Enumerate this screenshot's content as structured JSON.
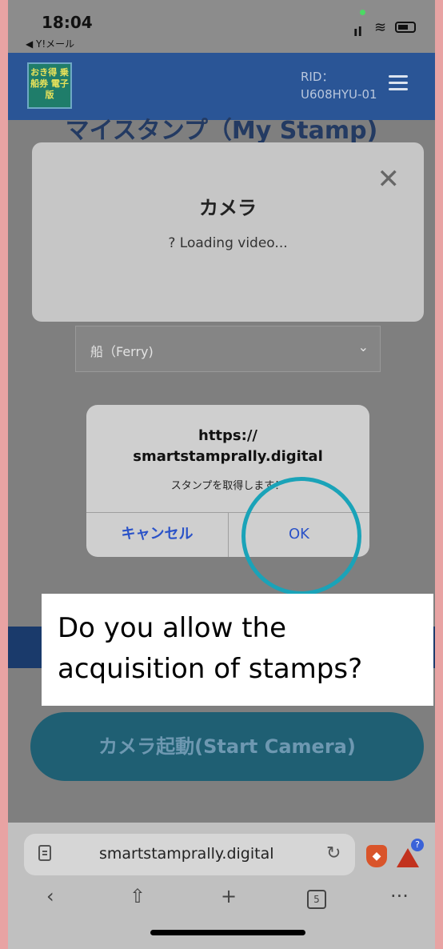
{
  "status_bar": {
    "time": "18:04",
    "back_app": "◀ Y!メール",
    "signal": "ıl",
    "wifi": "≋"
  },
  "header": {
    "logo_text": "おき得 乗船券 電子版",
    "rid_label": "RID：",
    "rid_value": "U608HYU-01"
  },
  "page": {
    "title": "マイスタンプ（My Stamp)",
    "select_value": "船（Ferry)",
    "camera_button": "カメラ起動(Start Camera)"
  },
  "camera_modal": {
    "title": "カメラ",
    "status": "? Loading video..."
  },
  "alert": {
    "url_line1": "https://",
    "url_line2": "smartstamprally.digital",
    "message": "スタンプを取得します！",
    "cancel_label": "キャンセル",
    "ok_label": "OK"
  },
  "annotation": {
    "line1": "Do you allow the",
    "line2": "acquisition of stamps?"
  },
  "browser": {
    "url": "smartstamprally.digital",
    "tab_count": "5",
    "badge": "?"
  },
  "colors": {
    "header": "#2a5596",
    "alert_button": "#2a52c8",
    "highlight": "#1aa3b8"
  }
}
